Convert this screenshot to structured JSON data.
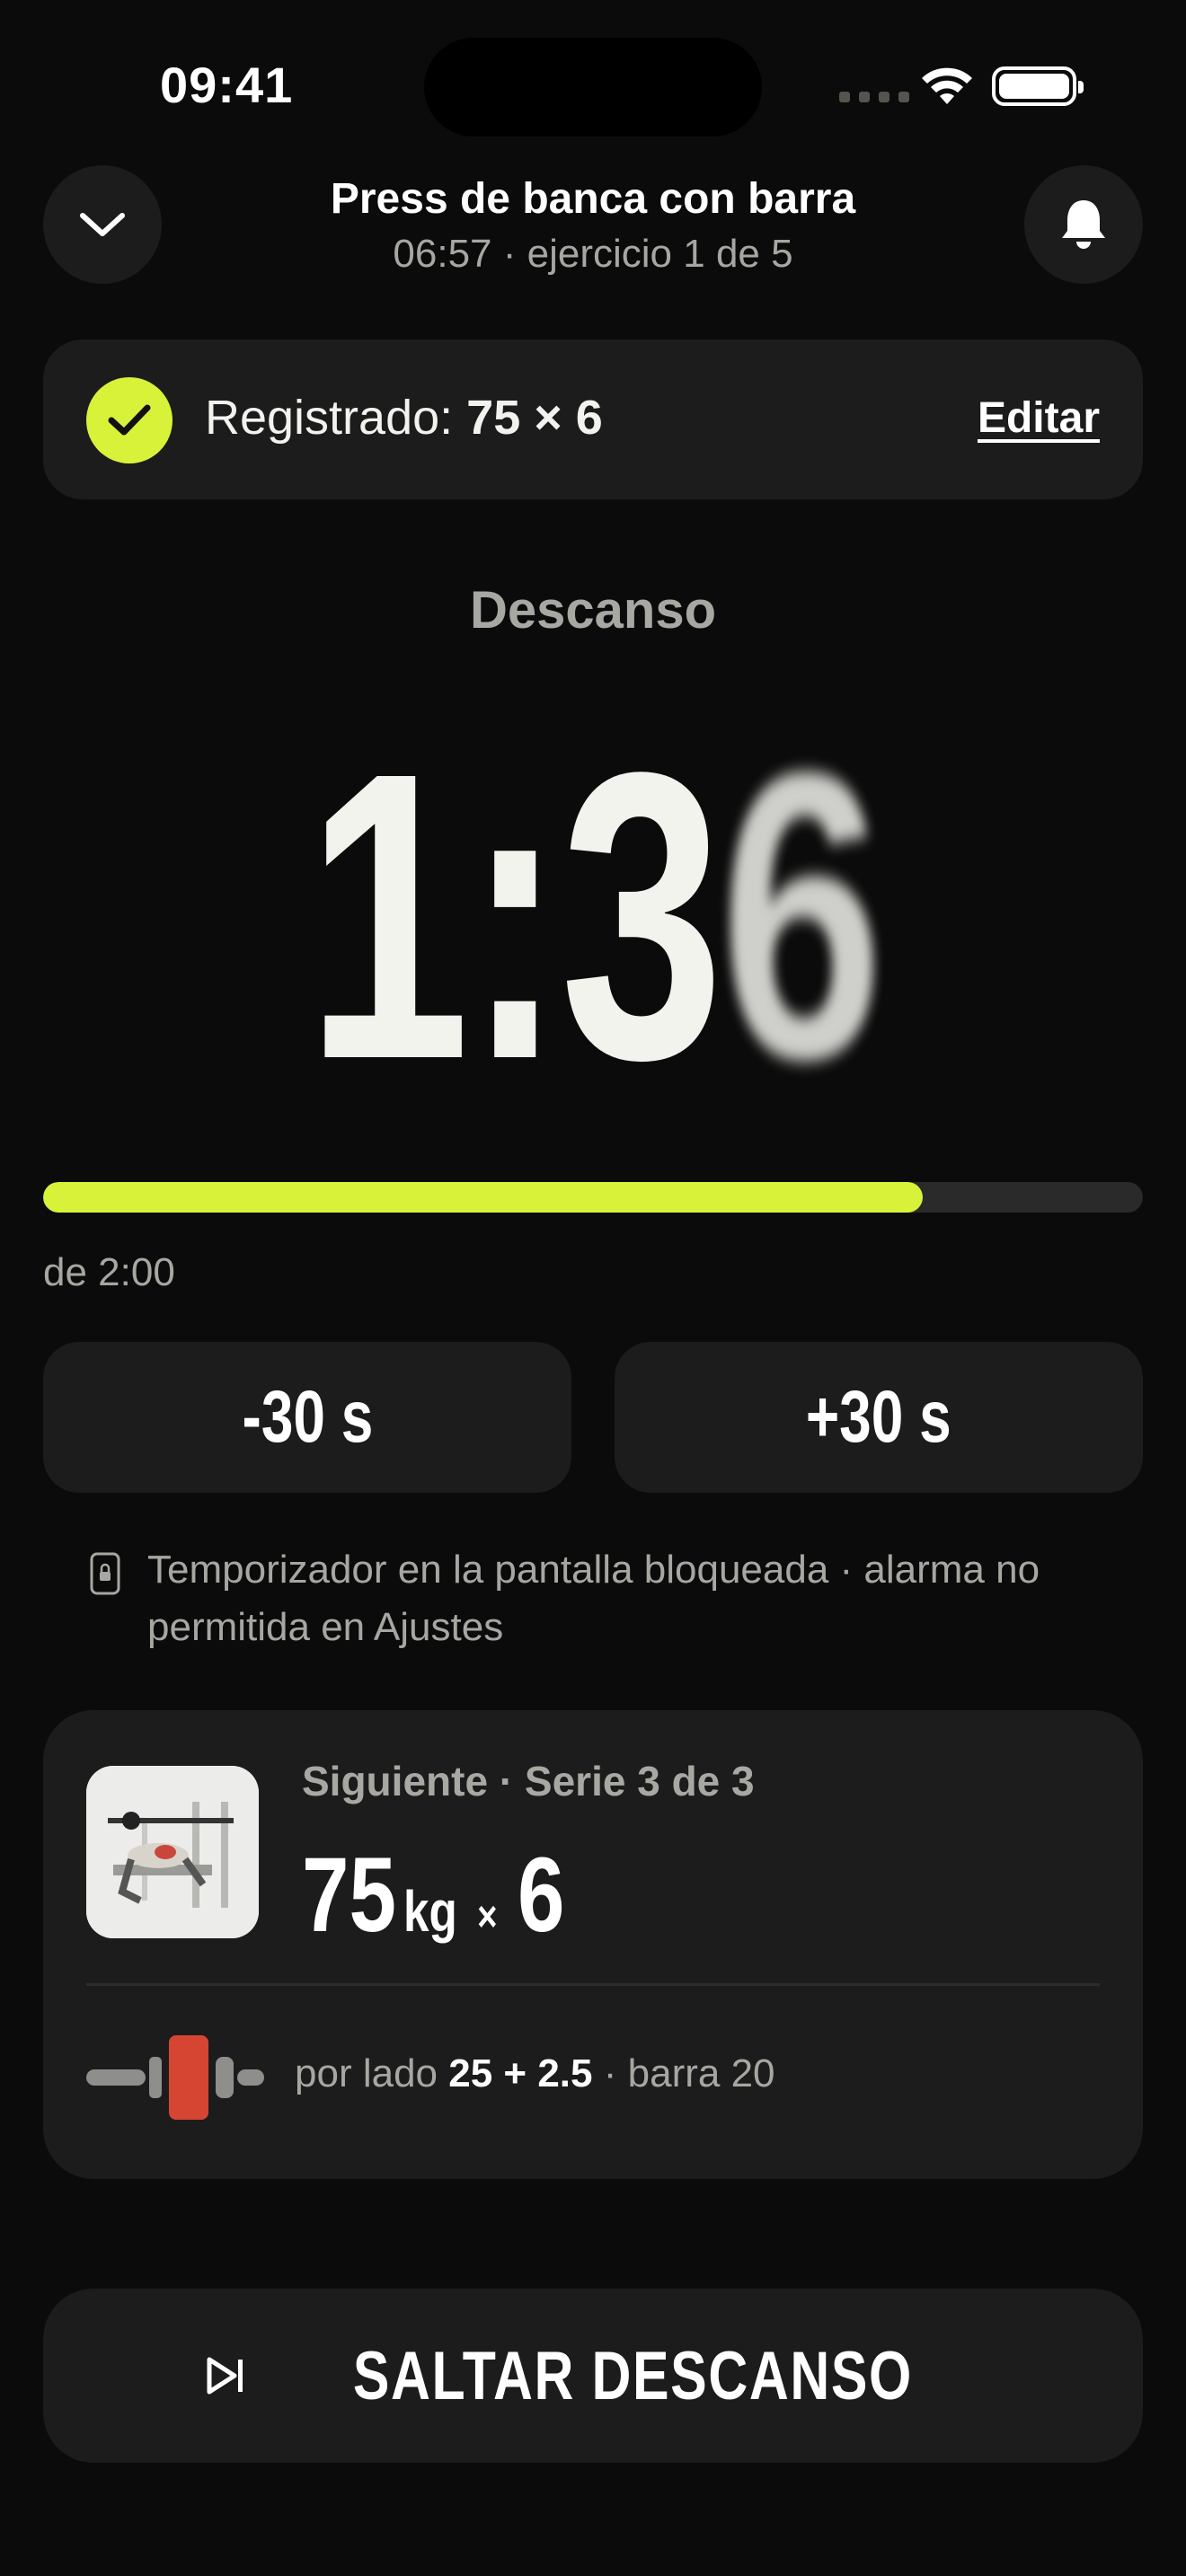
{
  "status_bar": {
    "time": "09:41"
  },
  "header": {
    "title": "Press de banca con barra",
    "elapsed": "06:57",
    "subtitle_rest": "· ejercicio 1 de 5"
  },
  "logged": {
    "prefix": "Registrado:",
    "value": "75 × 6",
    "edit_label": "Editar"
  },
  "rest": {
    "label": "Descanso",
    "timer_main": "1:3",
    "timer_blur": "6",
    "progress": 0.8,
    "total_label": "de 2:00",
    "minus_label": "-30 s",
    "plus_label": "+30 s"
  },
  "lock_note": "Temporizador en la pantalla bloqueada · alarma no permitida en Ajustes",
  "next": {
    "label": "Siguiente · Serie 3 de 3",
    "weight": "75",
    "unit": "kg",
    "times": "×",
    "reps": "6",
    "plate_prefix": "por lado",
    "plate_value": "25 + 2.5",
    "plate_suffix": "· barra 20"
  },
  "skip_label": "SALTAR DESCANSO",
  "colors": {
    "accent": "#d8f23a",
    "background": "#0b0b0b",
    "card": "#1c1c1c",
    "plate": "#d64532"
  },
  "icons": [
    "chevron-down-icon",
    "bell-icon",
    "check-icon",
    "lock-icon",
    "barbell-plate-icon",
    "skip-icon",
    "wifi-icon",
    "battery-icon"
  ]
}
